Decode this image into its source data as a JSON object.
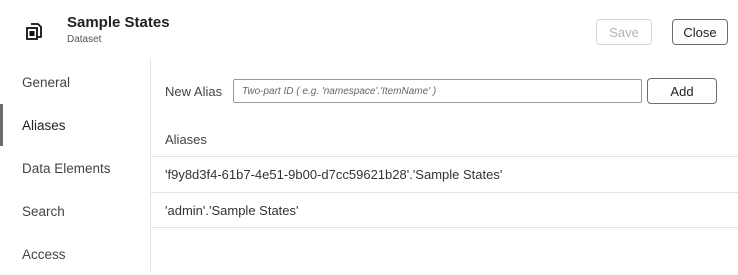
{
  "header": {
    "title": "Sample States",
    "subtitle": "Dataset",
    "icon": "dataset-icon",
    "save_label": "Save",
    "close_label": "Close"
  },
  "sidebar": {
    "items": [
      {
        "label": "General",
        "active": false
      },
      {
        "label": "Aliases",
        "active": true
      },
      {
        "label": "Data Elements",
        "active": false
      },
      {
        "label": "Search",
        "active": false
      },
      {
        "label": "Access",
        "active": false
      }
    ]
  },
  "main": {
    "new_alias_label": "New Alias",
    "new_alias_placeholder": "Two-part ID ( e.g. 'namespace'.'ItemName' )",
    "new_alias_value": "",
    "add_label": "Add",
    "aliases_heading": "Aliases",
    "aliases": [
      "'f9y8d3f4-61b7-4e51-9b00-d7cc59621b28'.'Sample States'",
      "'admin'.'Sample States'"
    ]
  },
  "colors": {
    "active_indicator": "#6b6b6b",
    "divider": "#e3e3e3",
    "disabled_text": "#b3b3b3"
  }
}
